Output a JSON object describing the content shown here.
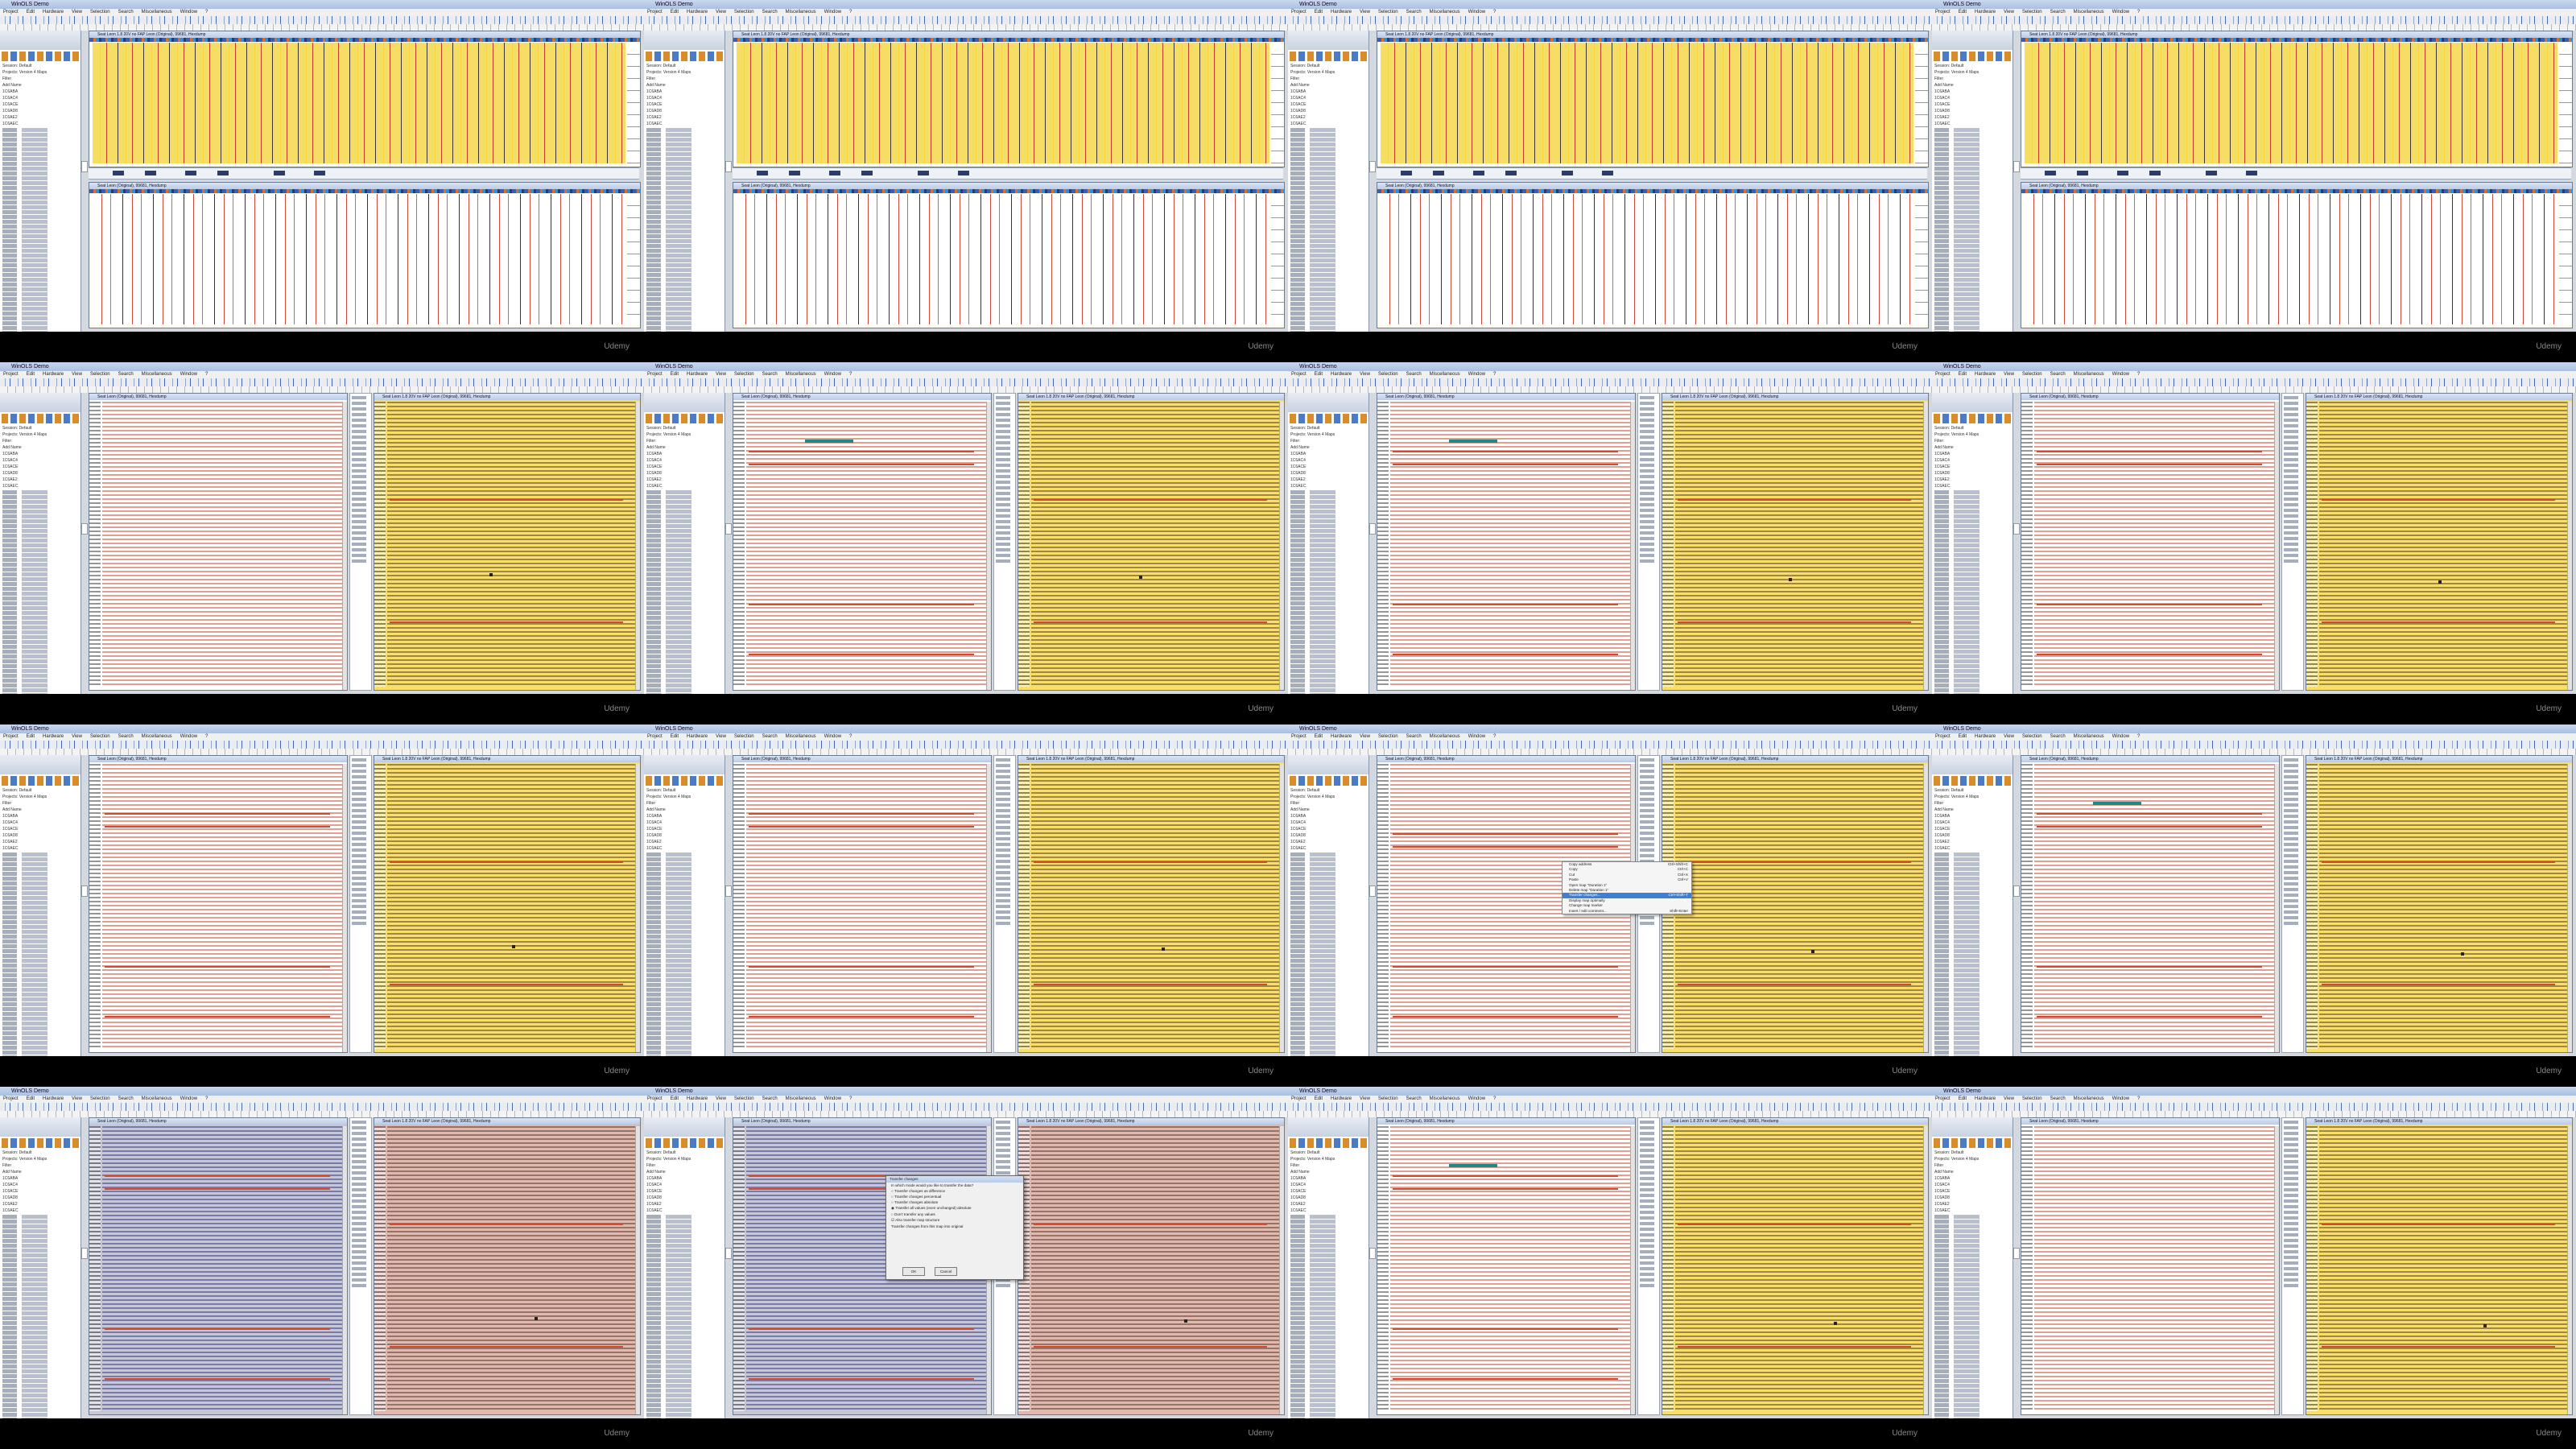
{
  "app": {
    "title": "WinOLS Demo",
    "menu": [
      "Project",
      "Edit",
      "Hardware",
      "View",
      "Selection",
      "Search",
      "Miscellaneous",
      "Window",
      "?"
    ]
  },
  "windows": {
    "map_project": "Seat Leon 1.8 20V no FAP Leon (Original), 99681, Hexdump",
    "map_original": "Seat Leon (Original), 99681, Hexdump"
  },
  "left_panel": {
    "session": "Session: Default",
    "projects_label": "Projects: Version 4 Maps",
    "filter_label": "Filter",
    "column_address": "Add",
    "column_name": "Name",
    "addresses": [
      "1C6ABA",
      "1C6AC4",
      "1C6ACE",
      "1C6AD8",
      "1C6AE2",
      "1C6AEC"
    ]
  },
  "context_menu": {
    "items": [
      "Copy address",
      "Copy",
      "Cut",
      "Paste",
      "Open map \"Duration 1\"",
      "Delete map \"Duration 1\"",
      "Transfer changes...",
      "Display map optimally",
      "Change map marker",
      "Insert / edit comment..."
    ],
    "shortcuts": [
      "Ctrl+Shift+C",
      "Ctrl+C",
      "Ctrl+X",
      "Ctrl+V",
      "",
      "",
      "Ctrl+Shift+T",
      "",
      "",
      "Shift+Enter"
    ],
    "highlight_index": 6
  },
  "dialog": {
    "title": "Transfer changes",
    "question": "In which mode would you like to transfer the data?",
    "options": [
      "Transfer changes as difference",
      "Transfer changes percentual",
      "Transfer changes absolute",
      "Transfer all values (even unchanged) absolute",
      "Don't transfer any values"
    ],
    "checkbox": "Also transfer map structure",
    "note": "Transfer changes from this map into original",
    "ok": "OK",
    "cancel": "Cancel"
  },
  "watermark": "Udemy"
}
